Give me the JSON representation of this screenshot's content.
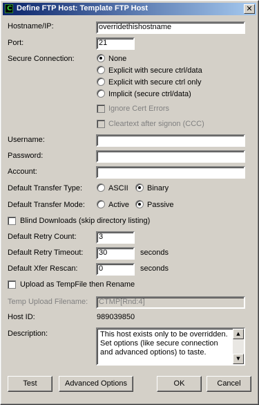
{
  "window": {
    "title": "Define FTP Host: Template FTP Host",
    "close_glyph": "✕",
    "app_icon_glyph": "C"
  },
  "hostname": {
    "label": "Hostname/IP:",
    "value": "overridethishostname"
  },
  "port": {
    "label": "Port:",
    "value": "21"
  },
  "secure_connection": {
    "label": "Secure Connection:",
    "options": [
      "None",
      "Explicit with secure ctrl/data",
      "Explicit with secure ctrl only",
      "Implicit (secure ctrl/data)"
    ],
    "selected": "None",
    "ignore_cert_errors": "Ignore Cert Errors",
    "cleartext_after_signon": "Cleartext after signon (CCC)"
  },
  "username": {
    "label": "Username:",
    "value": ""
  },
  "password": {
    "label": "Password:",
    "value": ""
  },
  "account": {
    "label": "Account:",
    "value": ""
  },
  "transfer_type": {
    "label": "Default Transfer Type:",
    "options": [
      "ASCII",
      "Binary"
    ],
    "selected": "Binary"
  },
  "transfer_mode": {
    "label": "Default Transfer Mode:",
    "options": [
      "Active",
      "Passive"
    ],
    "selected": "Passive"
  },
  "blind_downloads": {
    "label": "Blind Downloads (skip directory listing)",
    "checked": false
  },
  "retry_count": {
    "label": "Default Retry Count:",
    "value": "3"
  },
  "retry_timeout": {
    "label": "Default Retry Timeout:",
    "value": "30",
    "unit": "seconds"
  },
  "xfer_rescan": {
    "label": "Default Xfer Rescan:",
    "value": "0",
    "unit": "seconds"
  },
  "upload_tempfile": {
    "label": "Upload as TempFile then Rename",
    "checked": false
  },
  "temp_upload_filename": {
    "label": "Temp Upload Filename:",
    "value": "CTMP[Rnd:4]"
  },
  "host_id": {
    "label": "Host ID:",
    "value": "989039850"
  },
  "description": {
    "label": "Description:",
    "value": "This host exists only to be overridden. Set options (like secure connection and advanced options) to taste."
  },
  "buttons": {
    "test": "Test",
    "advanced": "Advanced Options",
    "ok": "OK",
    "cancel": "Cancel"
  },
  "icons": {
    "scroll_up": "▲",
    "scroll_down": "▼"
  }
}
